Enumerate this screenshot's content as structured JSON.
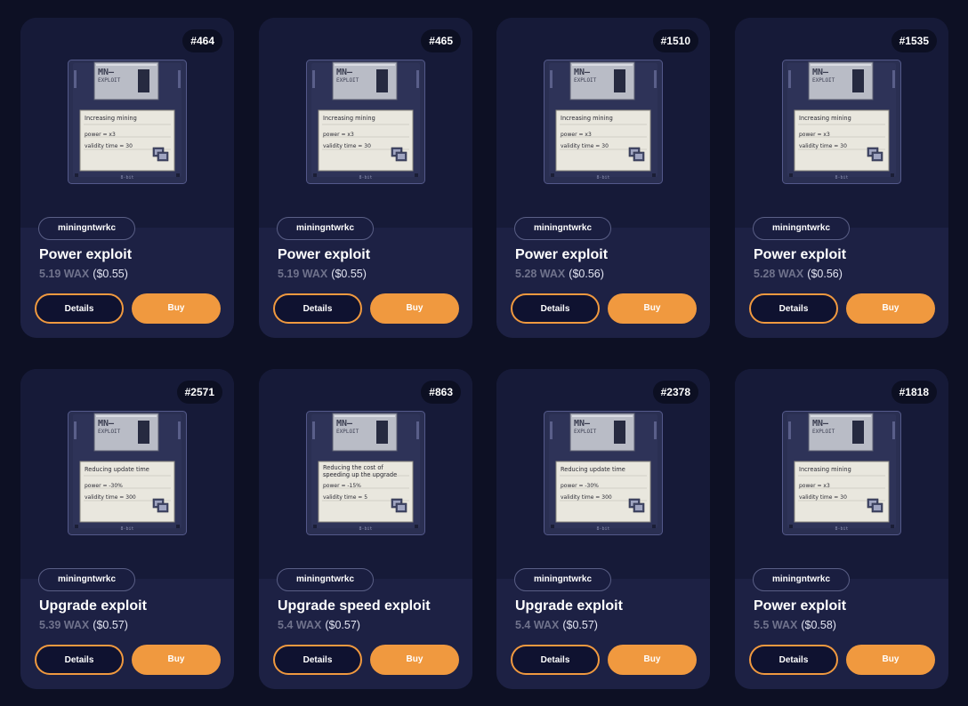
{
  "colors": {
    "page_background": "#0d1024",
    "card_background": "#1d2144",
    "accent": "#f0993f",
    "wax_text": "#6f728c"
  },
  "cards": [
    {
      "id_badge": "#464",
      "collection": "miningntwrkc",
      "title": "Power exploit",
      "price_wax": "5.19 WAX",
      "price_usd": "($0.55)",
      "details_label": "Details",
      "buy_label": "Buy",
      "disk": {
        "logo": "MN—",
        "logo_sub": "EXPLOIT",
        "label_title": "Increasing mining",
        "line1": "power = x3",
        "line2": "validity time = 30",
        "footer": "8-bit"
      }
    },
    {
      "id_badge": "#465",
      "collection": "miningntwrkc",
      "title": "Power exploit",
      "price_wax": "5.19 WAX",
      "price_usd": "($0.55)",
      "details_label": "Details",
      "buy_label": "Buy",
      "disk": {
        "logo": "MN—",
        "logo_sub": "EXPLOIT",
        "label_title": "Increasing mining",
        "line1": "power = x3",
        "line2": "validity time = 30",
        "footer": "8-bit"
      }
    },
    {
      "id_badge": "#1510",
      "collection": "miningntwrkc",
      "title": "Power exploit",
      "price_wax": "5.28 WAX",
      "price_usd": "($0.56)",
      "details_label": "Details",
      "buy_label": "Buy",
      "disk": {
        "logo": "MN—",
        "logo_sub": "EXPLOIT",
        "label_title": "Increasing mining",
        "line1": "power = x3",
        "line2": "validity time = 30",
        "footer": "8-bit"
      }
    },
    {
      "id_badge": "#1535",
      "collection": "miningntwrkc",
      "title": "Power exploit",
      "price_wax": "5.28 WAX",
      "price_usd": "($0.56)",
      "details_label": "Details",
      "buy_label": "Buy",
      "disk": {
        "logo": "MN—",
        "logo_sub": "EXPLOIT",
        "label_title": "Increasing mining",
        "line1": "power = x3",
        "line2": "validity time = 30",
        "footer": "8-bit"
      }
    },
    {
      "id_badge": "#2571",
      "collection": "miningntwrkc",
      "title": "Upgrade exploit",
      "price_wax": "5.39 WAX",
      "price_usd": "($0.57)",
      "details_label": "Details",
      "buy_label": "Buy",
      "disk": {
        "logo": "MN—",
        "logo_sub": "EXPLOIT",
        "label_title": "Reducing update time",
        "line1": "power = -30%",
        "line2": "validity time = 300",
        "footer": "8-bit"
      }
    },
    {
      "id_badge": "#863",
      "collection": "miningntwrkc",
      "title": "Upgrade speed exploit",
      "price_wax": "5.4 WAX",
      "price_usd": "($0.57)",
      "details_label": "Details",
      "buy_label": "Buy",
      "disk": {
        "logo": "MN—",
        "logo_sub": "EXPLOIT",
        "label_title": "Reducing the cost of speeding up the upgrade",
        "line1": "power = -15%",
        "line2": "validity time = 5",
        "footer": "8-bit"
      }
    },
    {
      "id_badge": "#2378",
      "collection": "miningntwrkc",
      "title": "Upgrade exploit",
      "price_wax": "5.4 WAX",
      "price_usd": "($0.57)",
      "details_label": "Details",
      "buy_label": "Buy",
      "disk": {
        "logo": "MN—",
        "logo_sub": "EXPLOIT",
        "label_title": "Reducing update time",
        "line1": "power = -30%",
        "line2": "validity time = 300",
        "footer": "8-bit"
      }
    },
    {
      "id_badge": "#1818",
      "collection": "miningntwrkc",
      "title": "Power exploit",
      "price_wax": "5.5 WAX",
      "price_usd": "($0.58)",
      "details_label": "Details",
      "buy_label": "Buy",
      "disk": {
        "logo": "MN—",
        "logo_sub": "EXPLOIT",
        "label_title": "Increasing mining",
        "line1": "power = x3",
        "line2": "validity time = 30",
        "footer": "8-bit"
      }
    }
  ]
}
